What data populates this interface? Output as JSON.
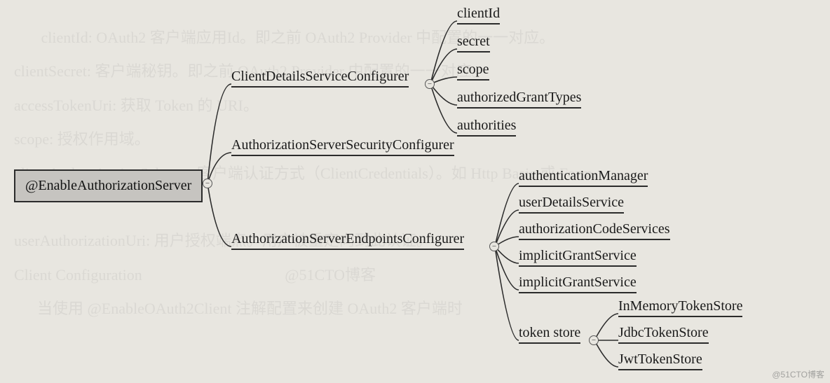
{
  "root": "@EnableAuthorizationServer",
  "branches": {
    "clientDetails": "ClientDetailsServiceConfigurer",
    "security": "AuthorizationServerSecurityConfigurer",
    "endpoints": "AuthorizationServerEndpointsConfigurer"
  },
  "clientDetailsChildren": {
    "c0": "clientId",
    "c1": "secret",
    "c2": "scope",
    "c3": "authorizedGrantTypes",
    "c4": "authorities"
  },
  "endpointsChildren": {
    "e0": "authenticationManager",
    "e1": "userDetailsService",
    "e2": "authorizationCodeServices",
    "e3": "implicitGrantService",
    "e4": "implicitGrantService",
    "e5": "token store"
  },
  "tokenStoreChildren": {
    "t0": "InMemoryTokenStore",
    "t1": "JdbcTokenStore",
    "t2": "JwtTokenStore"
  },
  "watermark": "@51CTO博客"
}
